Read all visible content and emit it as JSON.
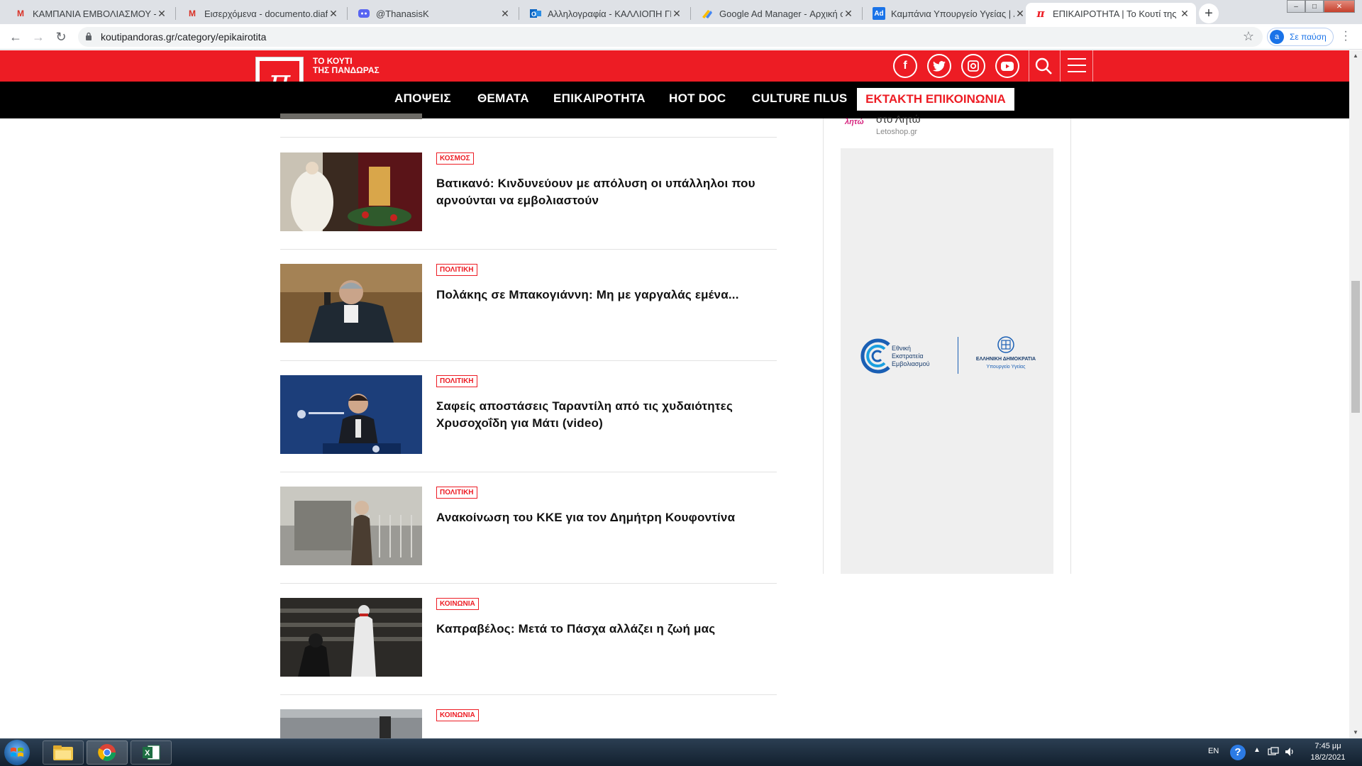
{
  "browser": {
    "tabs": [
      {
        "title": "ΚΑΜΠΑΝΙΑ ΕΜΒΟΛΙΑΣΜΟΥ - do",
        "icon": "gmail-icon"
      },
      {
        "title": "Εισερχόμενα - documento.diafim",
        "icon": "gmail-icon"
      },
      {
        "title": "@ThanasisK",
        "icon": "discord-icon"
      },
      {
        "title": "Αλληλογραφία - ΚΑΛΛΙΟΠΗ ΓΕΩ",
        "icon": "outlook-icon"
      },
      {
        "title": "Google Ad Manager - Αρχική σε",
        "icon": "ad-manager-icon"
      },
      {
        "title": "Καμπάνια Υπουργείο Υγείας | Ad",
        "icon": "adwords-icon"
      },
      {
        "title": "ΕΠΙΚΑΙΡΟΤΗΤΑ | Το Κουτί της Πα",
        "icon": "pandora-icon"
      }
    ],
    "url": "koutipandoras.gr/category/epikairotita",
    "profile_label": "Σε παύση",
    "profile_initial": "a"
  },
  "site": {
    "logo_line1": "ΤΟ ΚΟΥΤΙ",
    "logo_line2": "ΤΗΣ ΠΑΝΔΩΡΑΣ",
    "logo_symbol": "π",
    "accent": "#ed1c24",
    "social": [
      {
        "name": "facebook-icon",
        "glyph": "f"
      },
      {
        "name": "twitter-icon",
        "glyph": "t"
      },
      {
        "name": "instagram-icon",
        "glyph": "◎"
      },
      {
        "name": "youtube-icon",
        "glyph": "▶"
      }
    ],
    "menu": [
      "ΑΠΟΨΕΙΣ",
      "ΘΕΜΑΤΑ",
      "ΕΠΙΚΑΙΡΟΤΗΤΑ",
      "HOT DOC",
      "CULTURE ΠLUS"
    ],
    "menu_cta": "ΕΚΤΑΚΤΗ ΕΠΙΚΟΙΝΩΝΙΑ"
  },
  "articles": [
    {
      "category": "ΚΟΣΜΟΣ",
      "title": "Βατικανό: Κινδυνεύουν με απόλυση οι υπάλληλοι που αρνούνται να εμβολιαστούν"
    },
    {
      "category": "ΠΟΛΙΤΙΚΗ",
      "title": "Πολάκης σε Μπακογιάννη: Μη με γαργαλάς εμένα..."
    },
    {
      "category": "ΠΟΛΙΤΙΚΗ",
      "title": "Σαφείς αποστάσεις Ταραντίλη από τις χυδαιότητες Χρυσοχοΐδη για Μάτι (video)"
    },
    {
      "category": "ΠΟΛΙΤΙΚΗ",
      "title": "Ανακοίνωση του ΚΚΕ για τον Δημήτρη Κουφοντίνα"
    },
    {
      "category": "ΚΟΙΝΩΝΙΑ",
      "title": "Καπραβέλος: Μετά το Πάσχα αλλάζει η ζωή μας"
    },
    {
      "category": "ΚΟΙΝΩΝΙΑ",
      "title": ""
    }
  ],
  "sidebar": {
    "sponsor_logo": "λητώ",
    "sponsor_title": "στο Λητώ",
    "sponsor_source": "Letoshop.gr",
    "ad": {
      "campaign_line1": "Εθνική",
      "campaign_line2": "Εκστρατεία",
      "campaign_line3": "Εμβολιασμού",
      "gov_line1": "ΕΛΛΗΝΙΚΗ ΔΗΜΟΚΡΑΤΙΑ",
      "gov_line2": "Υπουργείο Υγείας"
    }
  },
  "taskbar": {
    "language": "EN",
    "time": "7:45 μμ",
    "date": "18/2/2021",
    "apps": [
      "explorer-icon",
      "chrome-icon",
      "excel-icon"
    ]
  }
}
